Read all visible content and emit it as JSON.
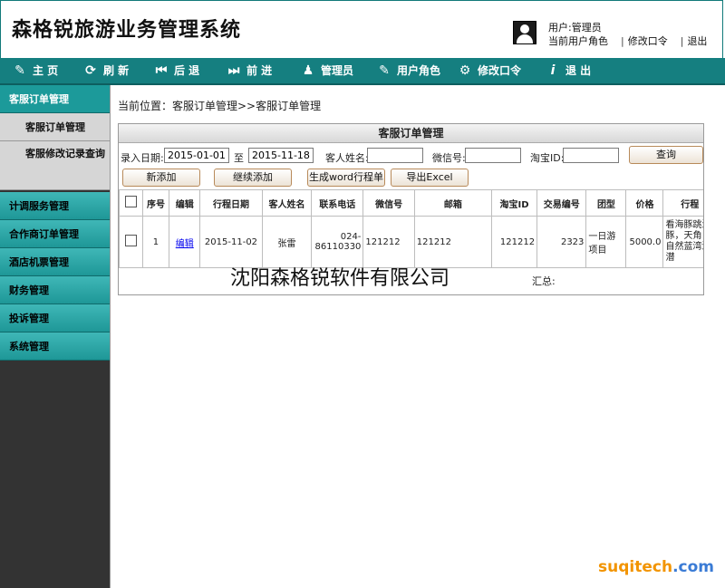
{
  "app": {
    "title": "森格锐旅游业务管理系统"
  },
  "user": {
    "label": "用户:管理员",
    "current_role": "当前用户角色",
    "change_password": "修改口令",
    "logout": "退出"
  },
  "toolbar": {
    "items": [
      {
        "label": "主 页",
        "icon": "edit-icon"
      },
      {
        "label": "刷 新",
        "icon": "refresh-icon"
      },
      {
        "label": "后 退",
        "icon": "back-icon"
      },
      {
        "label": "前 进",
        "icon": "forward-icon"
      },
      {
        "label": "管理员",
        "icon": "user-icon"
      },
      {
        "label": "用户角色",
        "icon": "edit-icon"
      },
      {
        "label": "修改口令",
        "icon": "gear-icon"
      },
      {
        "label": "退 出",
        "icon": "info-icon"
      }
    ]
  },
  "sidebar": {
    "items": [
      {
        "label": "客服订单管理"
      },
      {
        "label": "计调服务管理"
      },
      {
        "label": "合作商订单管理"
      },
      {
        "label": "酒店机票管理"
      },
      {
        "label": "财务管理"
      },
      {
        "label": "投诉管理"
      },
      {
        "label": "系统管理"
      }
    ],
    "subitems": [
      {
        "label": "客服订单管理"
      },
      {
        "label": "客服修改记录查询"
      }
    ]
  },
  "breadcrumb": "当前位置：客服订单管理>>客服订单管理",
  "panel": {
    "title": "客服订单管理",
    "search": {
      "date_label": "录入日期:",
      "date_from": "2015-01-01",
      "to_label": "至",
      "date_to": "2015-11-18",
      "name_label": "客人姓名:",
      "name_value": "",
      "wechat_label": "微信号:",
      "wechat_value": "",
      "taobao_label": "淘宝ID:",
      "taobao_value": "",
      "query_button": "查询"
    },
    "actions": {
      "new": "新添加",
      "continue_add": "继续添加",
      "gen_word": "生成word行程单",
      "export_excel": "导出Excel"
    },
    "table": {
      "headers": [
        "序号",
        "编辑",
        "行程日期",
        "客人姓名",
        "联系电话",
        "微信号",
        "邮箱",
        "淘宝ID",
        "交易编号",
        "团型",
        "价格",
        "行程"
      ],
      "rows": [
        {
          "seq": "1",
          "edit": "编辑",
          "date": "2015-11-02",
          "name": "张雷",
          "phone": "024-86110330",
          "wechat": "121212",
          "email": "121212",
          "taobao": "121212",
          "trade": "2323",
          "group": "一日游项目",
          "price": "5000.0",
          "trip": "看海豚跳海豚，天角，自然蓝湾浮潜"
        }
      ],
      "summary_label": "汇总:"
    }
  },
  "watermark": "沈阳森格锐软件有限公司",
  "brand": {
    "part1": "suqitech",
    "part2": ".com"
  }
}
